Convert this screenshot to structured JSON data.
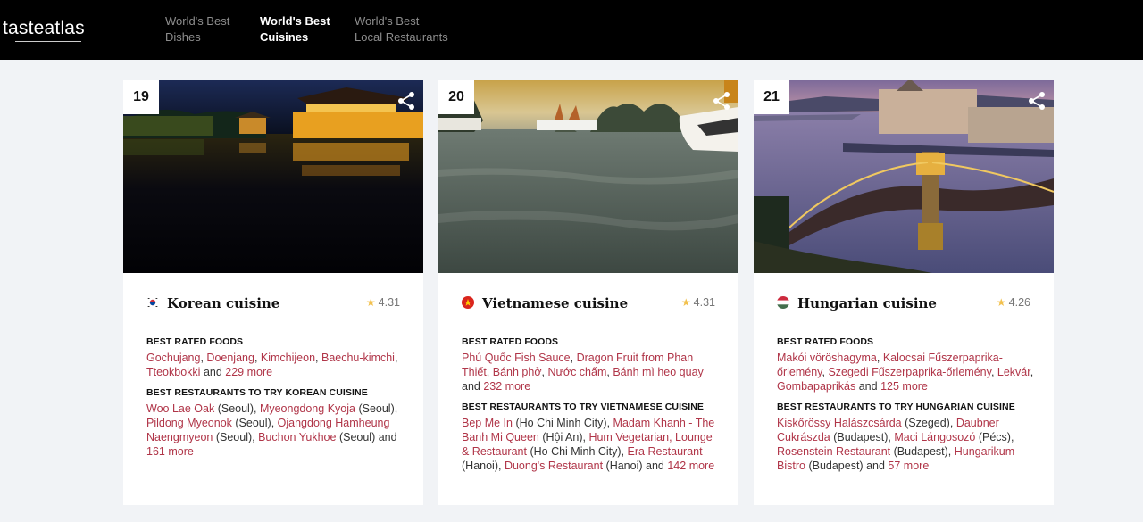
{
  "header": {
    "logo": "tasteatlas",
    "nav": [
      {
        "line1": "World's Best",
        "line2": "Dishes"
      },
      {
        "line1": "World's Best",
        "line2": "Cuisines"
      },
      {
        "line1": "World's Best",
        "line2": "Local Restaurants"
      }
    ]
  },
  "cards": [
    {
      "rank": "19",
      "name": "Korean cuisine",
      "rating": "4.31",
      "foods_heading": "BEST RATED FOODS",
      "foods": [
        "Gochujang",
        "Doenjang",
        "Kimchijeon",
        "Baechu-kimchi",
        "Tteokbokki"
      ],
      "foods_and": "and",
      "foods_more": "229 more",
      "restaurants_heading": "BEST RESTAURANTS TO TRY KOREAN CUISINE",
      "restaurants": [
        {
          "name": "Woo Lae Oak",
          "city": "(Seoul)"
        },
        {
          "name": "Myeongdong Kyoja",
          "city": "(Seoul)"
        },
        {
          "name": "Pildong Myeonok",
          "city": "(Seoul)"
        },
        {
          "name": "Ojangdong Hamheung Naengmyeon",
          "city": "(Seoul)"
        },
        {
          "name": "Buchon Yukhoe",
          "city": "(Seoul)"
        }
      ],
      "restaurants_and": "and",
      "restaurants_more": "161 more"
    },
    {
      "rank": "20",
      "name": "Vietnamese cuisine",
      "rating": "4.31",
      "foods_heading": "BEST RATED FOODS",
      "foods": [
        "Phú Quốc Fish Sauce",
        "Dragon Fruit from Phan Thiết",
        "Bánh phở",
        "Nước chấm",
        "Bánh mì heo quay"
      ],
      "foods_and": "and",
      "foods_more": "232 more",
      "restaurants_heading": "BEST RESTAURANTS TO TRY VIETNAMESE CUISINE",
      "restaurants": [
        {
          "name": "Bep Me In",
          "city": "(Ho Chi Minh City)"
        },
        {
          "name": "Madam Khanh - The Banh Mi Queen",
          "city": "(Hội An)"
        },
        {
          "name": "Hum Vegetarian, Lounge & Restaurant",
          "city": "(Ho Chi Minh City)"
        },
        {
          "name": "Era Restaurant",
          "city": "(Hanoi)"
        },
        {
          "name": "Duong's Restaurant",
          "city": "(Hanoi)"
        }
      ],
      "restaurants_and": "and",
      "restaurants_more": "142 more"
    },
    {
      "rank": "21",
      "name": "Hungarian cuisine",
      "rating": "4.26",
      "foods_heading": "BEST RATED FOODS",
      "foods": [
        "Makói vöröshagyma",
        "Kalocsai Fűszerpaprika-őrlemény",
        "Szegedi Fűszerpaprika-őrlemény",
        "Lekvár",
        "Gombapaprikás"
      ],
      "foods_and": "and",
      "foods_more": "125 more",
      "restaurants_heading": "BEST RESTAURANTS TO TRY HUNGARIAN CUISINE",
      "restaurants": [
        {
          "name": "Kiskőrössy Halászcsárda",
          "city": "(Szeged)"
        },
        {
          "name": "Daubner Cukrászda",
          "city": "(Budapest)"
        },
        {
          "name": "Maci Lángosozó",
          "city": "(Pécs)"
        },
        {
          "name": "Rosenstein Restaurant",
          "city": "(Budapest)"
        },
        {
          "name": "Hungarikum Bistro",
          "city": "(Budapest)"
        }
      ],
      "restaurants_and": "and",
      "restaurants_more": "57 more"
    }
  ],
  "icons": {
    "share": "share-icon",
    "star": "star-icon",
    "flags": [
      "south-korea-flag-icon",
      "vietnam-flag-icon",
      "hungary-flag-icon"
    ]
  },
  "colors": {
    "header_bg": "#000000",
    "link": "#b03548",
    "star": "#f2c14e",
    "page_bg": "#f1f3f6"
  }
}
